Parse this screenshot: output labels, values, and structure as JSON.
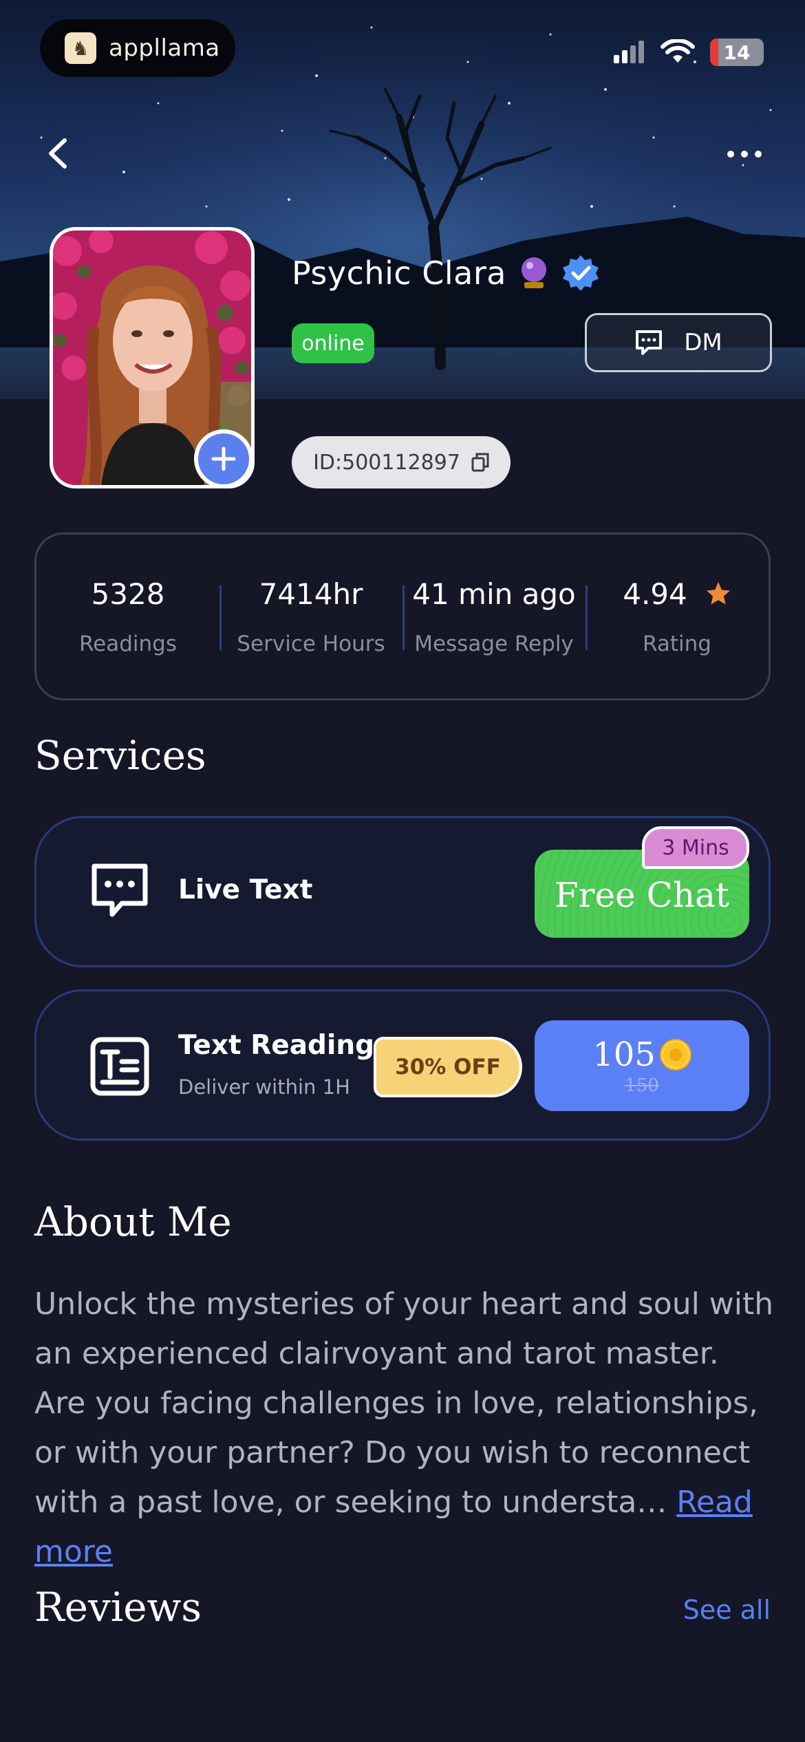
{
  "status_bar": {
    "brand": "appllama",
    "battery": "14"
  },
  "profile": {
    "name": "Psychic Clara",
    "status": "online",
    "dm_label": "DM",
    "id_text": "ID:500112897"
  },
  "stats": [
    {
      "value": "5328",
      "label": "Readings"
    },
    {
      "value": "7414hr",
      "label": "Service Hours"
    },
    {
      "value": "41 min ago",
      "label": "Message Reply"
    },
    {
      "value": "4.94",
      "label": "Rating"
    }
  ],
  "services": {
    "title": "Services",
    "live_text": {
      "label": "Live Text",
      "button": "Free Chat",
      "tag": "3 Mins"
    },
    "text_reading": {
      "label": "Text Reading",
      "sub": "Deliver within 1H",
      "discount": "30% OFF",
      "price": "105",
      "old_price": "150"
    }
  },
  "about": {
    "title": "About Me",
    "text": "Unlock the mysteries of your heart and soul with an experienced clairvoyant and tarot master. Are you facing challenges in love, relationships, or with your partner? Do you wish to reconnect with a past love, or seeking to understa…",
    "read_more": "Read more"
  },
  "reviews": {
    "title": "Reviews",
    "see_all": "See all"
  },
  "colors": {
    "background": "#151727",
    "accent": "#5b80f5",
    "online": "#2fc247",
    "free_chat": "#4ccb55",
    "discount": "#f7d378",
    "rating_star": "#f08a3c"
  },
  "icons": [
    "back-icon",
    "more-icon",
    "signal-icon",
    "wifi-icon",
    "battery-icon",
    "crystal-ball-icon",
    "verified-icon",
    "chat-icon",
    "copy-icon",
    "plus-icon",
    "star-icon",
    "live-text-icon",
    "text-reading-icon",
    "coin-icon"
  ]
}
